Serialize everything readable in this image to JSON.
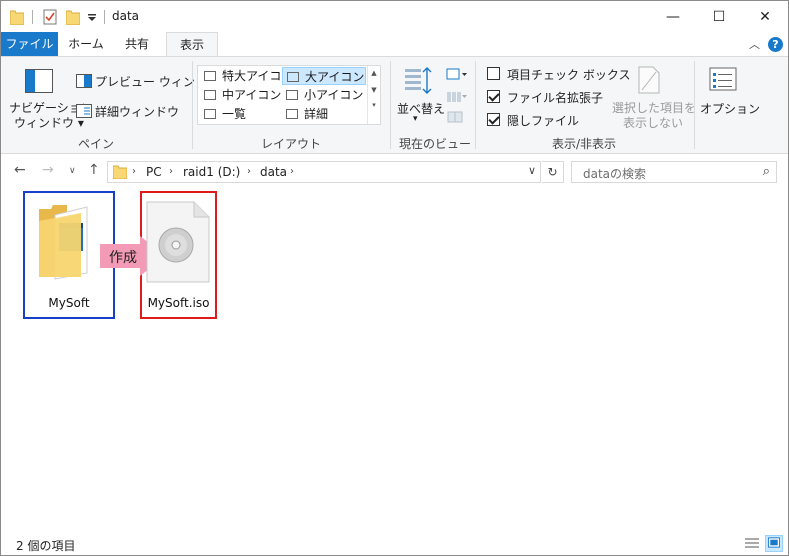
{
  "window": {
    "title": "data",
    "minimize": "—",
    "maximize": "☐",
    "close": "✕"
  },
  "ribbon_tabs": {
    "file": "ファイル",
    "home": "ホーム",
    "share": "共有",
    "view": "表示"
  },
  "ribbon": {
    "panes": {
      "nav_pane_line1": "ナビゲーション",
      "nav_pane_line2": "ウィンドウ",
      "preview_pane": "プレビュー ウィンドウ",
      "details_pane": "詳細ウィンドウ",
      "label": "ペイン"
    },
    "layout": {
      "items": [
        "特大アイコン",
        "大アイコン",
        "中アイコン",
        "小アイコン",
        "一覧",
        "詳細"
      ],
      "selected": "大アイコン",
      "label": "レイアウト"
    },
    "current_view": {
      "sort_by": "並べ替え",
      "label": "現在のビュー"
    },
    "show_hide": {
      "item_checkboxes": "項目チェック ボックス",
      "item_checkboxes_checked": false,
      "file_extensions": "ファイル名拡張子",
      "file_extensions_checked": true,
      "hidden_items": "隠しファイル",
      "hidden_items_checked": true,
      "hide_selected_line1": "選択した項目を",
      "hide_selected_line2": "表示しない",
      "label": "表示/非表示"
    },
    "options": "オプション"
  },
  "address_bar": {
    "crumbs": [
      "PC",
      "raid1 (D:)",
      "data"
    ],
    "search_placeholder": "dataの検索"
  },
  "content": {
    "items": [
      {
        "name": "MySoft",
        "type": "folder"
      },
      {
        "name": "MySoft.iso",
        "type": "disc-image"
      }
    ],
    "arrow_label": "作成",
    "colors": {
      "blue_frame": "#1640c8",
      "red_frame": "#e01b1b",
      "arrow": "#f39ab6"
    }
  },
  "status_bar": {
    "item_count": "2 個の項目"
  }
}
